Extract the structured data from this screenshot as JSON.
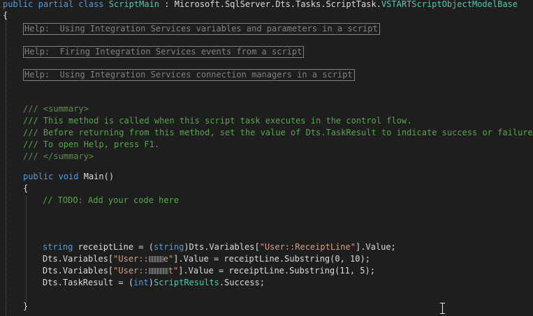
{
  "editor": {
    "class_decl": {
      "kw_public": "public",
      "kw_partial": "partial",
      "kw_class": "class",
      "class_name": "ScriptMain",
      "colon": " : ",
      "base_ns": "Microsoft.SqlServer.Dts.Tasks.ScriptTask.",
      "base_type": "VSTARTScriptObjectModelBase"
    },
    "brace_open": "{",
    "regions": [
      "Help:  Using Integration Services variables and parameters in a script",
      "Help:  Firing Integration Services events from a script",
      "Help:  Using Integration Services connection managers in a script"
    ],
    "doc_comment": {
      "prefix": "/// ",
      "summary_open": "<summary>",
      "line1": "This method is called when this script task executes in the control flow.",
      "line2": "Before returning from this method, set the value of Dts.TaskResult to indicate success or failure.",
      "line3": "To open Help, press F1.",
      "summary_close": "</summary>"
    },
    "main_decl": {
      "kw_public": "public",
      "kw_void": "void",
      "name": "Main()"
    },
    "todo_comment": "// TODO: Add your code here",
    "statements": {
      "s1": {
        "kw_string": "string",
        "mid1": " receiptLine = (",
        "cast": "string",
        "mid2": ")Dts.Variables[",
        "key": "\"User::ReceiptLine\"",
        "end": "].Value;"
      },
      "s2": {
        "start": "Dts.Variables[",
        "key_start": "\"User::",
        "key_end": "e\"",
        "end": "].Value = receiptLine.Substring(0, 10);"
      },
      "s3": {
        "start": "Dts.Variables[",
        "key_start": "\"User::",
        "key_end": "t\"",
        "end": "].Value = receiptLine.Substring(11, 5);"
      },
      "s4": {
        "start": "Dts.TaskResult = (",
        "cast": "int",
        "mid": ")",
        "type": "ScriptResults",
        "end": ".Success;"
      }
    },
    "brace_close": "}"
  },
  "colors": {
    "background": "#1e1e1e",
    "keyword": "#569cd6",
    "type": "#4ec9b0",
    "string": "#d69d85",
    "comment": "#57a64a"
  }
}
